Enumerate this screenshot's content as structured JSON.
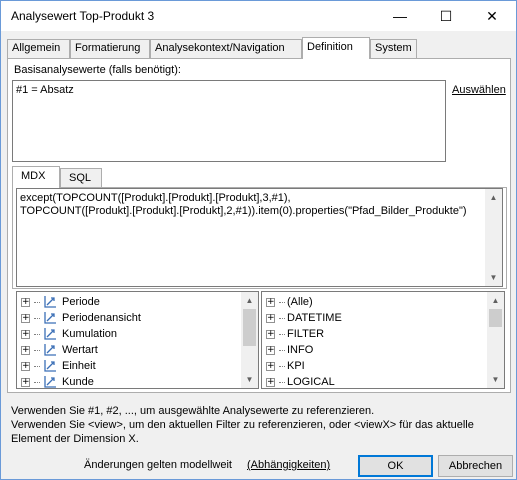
{
  "window": {
    "title": "Analysewert Top-Produkt 3",
    "controls": {
      "minimize": "—",
      "maximize": "☐",
      "close": "✕"
    }
  },
  "tabs": [
    {
      "label": "Allgemein",
      "active": false
    },
    {
      "label": "Formatierung",
      "active": false
    },
    {
      "label": "Analysekontext/Navigation",
      "active": false
    },
    {
      "label": "Definition",
      "active": true
    },
    {
      "label": "System",
      "active": false
    }
  ],
  "definition": {
    "base_label": "Basisanalysewerte (falls benötigt):",
    "base_value": "#1 = Absatz",
    "select_link": "Auswählen",
    "subtabs": [
      {
        "label": "MDX",
        "active": true
      },
      {
        "label": "SQL",
        "active": false
      }
    ],
    "mdx_line1": "except(TOPCOUNT([Produkt].[Produkt].[Produkt],3,#1),",
    "mdx_line2": "TOPCOUNT([Produkt].[Produkt].[Produkt],2,#1)).item(0).properties(\"Pfad_Bilder_Produkte\")",
    "left_tree": [
      "Periode",
      "Periodenansicht",
      "Kumulation",
      "Wertart",
      "Einheit",
      "Kunde"
    ],
    "right_tree": [
      "(Alle)",
      "DATETIME",
      "FILTER",
      "INFO",
      "KPI",
      "LOGICAL"
    ]
  },
  "hints": {
    "line1": "Verwenden Sie #1, #2, ..., um ausgewählte Analysewerte zu referenzieren.",
    "line2": "Verwenden Sie <view>, um den aktuellen Filter zu referenzieren, oder <viewX> für das aktuelle",
    "line3": "Element der Dimension X."
  },
  "footer": {
    "note": "Änderungen gelten modellweit",
    "dependencies_link": "(Abhängigkeiten)",
    "ok_label": "OK",
    "cancel_label": "Abbrechen"
  },
  "colors": {
    "accent": "#0078d7",
    "window_border": "#6a9ad8",
    "dimension_icon": "#3b6fb6"
  },
  "icons": {
    "tree_item": "dimension-icon",
    "expand": "plus-icon"
  }
}
